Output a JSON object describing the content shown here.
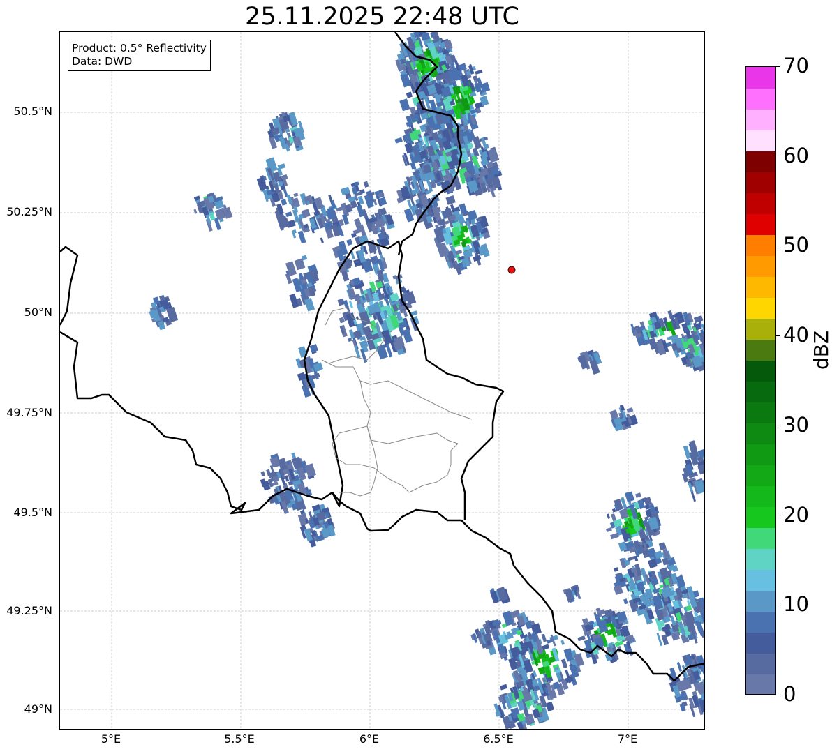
{
  "title": "25.11.2025 22:48 UTC",
  "info": {
    "product": "Product: 0.5° Reflectivity",
    "data": "Data: DWD"
  },
  "axes": {
    "lat_ticks": [
      "50.5°N",
      "50.25°N",
      "50°N",
      "49.75°N",
      "49.5°N",
      "49.25°N",
      "49°N"
    ],
    "lon_ticks": [
      "5°E",
      "5.5°E",
      "6°E",
      "6.5°E",
      "7°E"
    ]
  },
  "colorbar": {
    "unit": "dBZ",
    "tick_labels": [
      "0",
      "10",
      "20",
      "30",
      "40",
      "50",
      "60",
      "70"
    ],
    "colors": [
      "#6878a8",
      "#576ba0",
      "#455c9c",
      "#4a72b0",
      "#5a98c8",
      "#68c0e0",
      "#60d4c4",
      "#40d878",
      "#16c81e",
      "#14b81a",
      "#12a816",
      "#109a14",
      "#0e8a12",
      "#0a7a10",
      "#086a0e",
      "#045a0a",
      "#4a7a10",
      "#aab00a",
      "#ffd600",
      "#ffb800",
      "#ff9a00",
      "#ff7e00",
      "#e00000",
      "#c00000",
      "#a00000",
      "#7e0000",
      "#ffe0ff",
      "#ffb0ff",
      "#ff70ff",
      "#e836e8"
    ]
  },
  "radar_marker": {
    "color": "#ee1111"
  },
  "colors": {
    "country_border": "#000000",
    "region_border": "#888888"
  }
}
